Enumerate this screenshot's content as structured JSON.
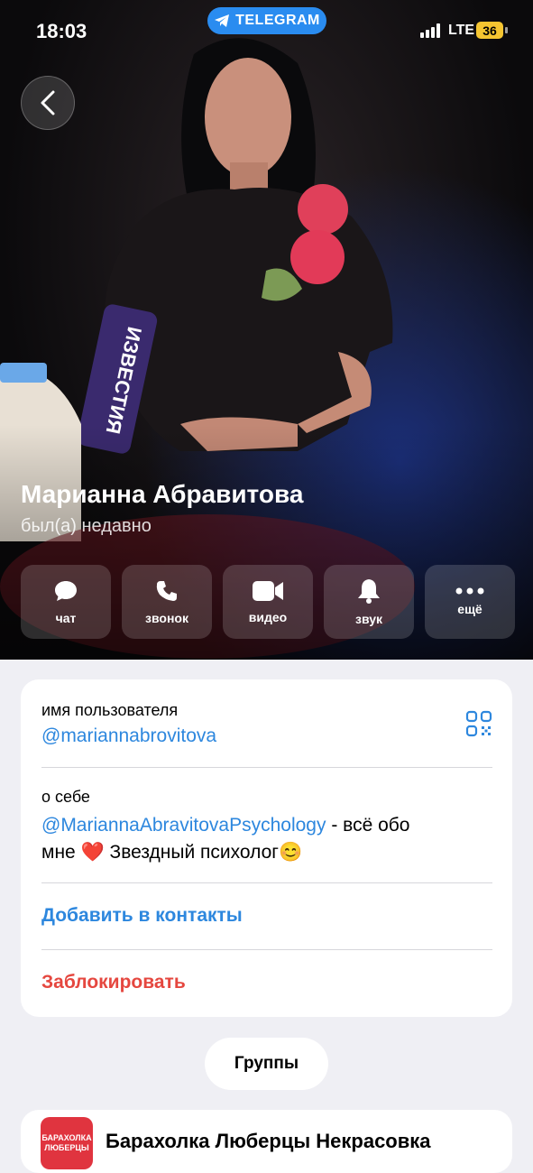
{
  "status_bar": {
    "time": "18:03",
    "app_badge": "TELEGRAM",
    "network": "LTE",
    "battery": "36"
  },
  "profile": {
    "name": "Марианна Абравитова",
    "last_seen": "был(а) недавно"
  },
  "actions": [
    {
      "label": "чат",
      "icon": "chat-bubble-icon"
    },
    {
      "label": "звонок",
      "icon": "phone-icon"
    },
    {
      "label": "видео",
      "icon": "video-camera-icon"
    },
    {
      "label": "звук",
      "icon": "bell-icon"
    },
    {
      "label": "ещё",
      "icon": "more-dots-icon"
    }
  ],
  "info": {
    "username_label": "имя пользователя",
    "username_value": "@mariannabrovitova",
    "bio_label": "о себе",
    "bio_link": "@MariannaAbravitovaPsychology",
    "bio_text_1": " - всё обо",
    "bio_text_2": "мне ❤️ Звездный психолог😊",
    "add_contact": "Добавить в контакты",
    "block": "Заблокировать"
  },
  "groups_button": "Группы",
  "group": {
    "name": "Барахолка Люберцы Некрасовка",
    "thumb_text": "БАРАХОЛКА ЛЮБЕРЦЫ"
  },
  "colors": {
    "accent_blue": "#2d87de",
    "destructive_red": "#e5473f",
    "telegram_blue": "#2a8cf0",
    "battery_yellow": "#f5c531"
  }
}
